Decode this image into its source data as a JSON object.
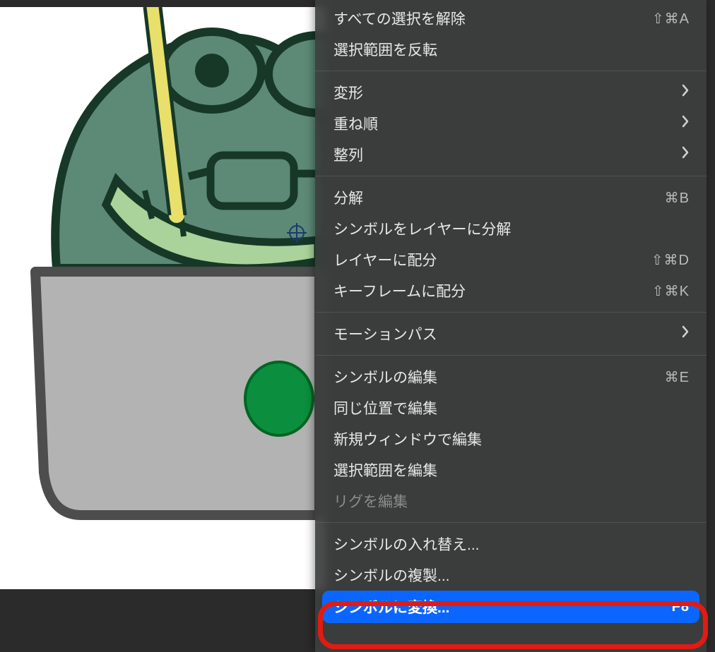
{
  "menu": {
    "items": [
      {
        "label": "すべての選択を解除",
        "shortcut": "⇧⌘A",
        "type": "item"
      },
      {
        "label": "選択範囲を反転",
        "type": "item"
      },
      {
        "type": "sep"
      },
      {
        "label": "変形",
        "type": "submenu"
      },
      {
        "label": "重ね順",
        "type": "submenu"
      },
      {
        "label": "整列",
        "type": "submenu"
      },
      {
        "type": "sep"
      },
      {
        "label": "分解",
        "shortcut": "⌘B",
        "type": "item"
      },
      {
        "label": "シンボルをレイヤーに分解",
        "type": "item"
      },
      {
        "label": "レイヤーに配分",
        "shortcut": "⇧⌘D",
        "type": "item"
      },
      {
        "label": "キーフレームに配分",
        "shortcut": "⇧⌘K",
        "type": "item"
      },
      {
        "type": "sep"
      },
      {
        "label": "モーションパス",
        "type": "submenu"
      },
      {
        "type": "sep"
      },
      {
        "label": "シンボルの編集",
        "shortcut": "⌘E",
        "type": "item"
      },
      {
        "label": "同じ位置で編集",
        "type": "item"
      },
      {
        "label": "新規ウィンドウで編集",
        "type": "item"
      },
      {
        "label": "選択範囲を編集",
        "type": "item"
      },
      {
        "label": "リグを編集",
        "type": "item",
        "disabled": true
      },
      {
        "type": "sep"
      },
      {
        "label": "シンボルの入れ替え...",
        "type": "item"
      },
      {
        "label": "シンボルの複製...",
        "type": "item"
      },
      {
        "label": "シンボルに変換...",
        "shortcut": "F8",
        "type": "item",
        "highlighted": true
      }
    ]
  },
  "canvas": {
    "illustration": "frog-with-laptop",
    "colors": {
      "frog_body": "#5d8a77",
      "frog_dark": "#173827",
      "mouth": "#a9d39a",
      "rope": "#e8e06a",
      "laptop": "#b3b3b3",
      "laptop_logo": "#0b8f3f"
    }
  }
}
